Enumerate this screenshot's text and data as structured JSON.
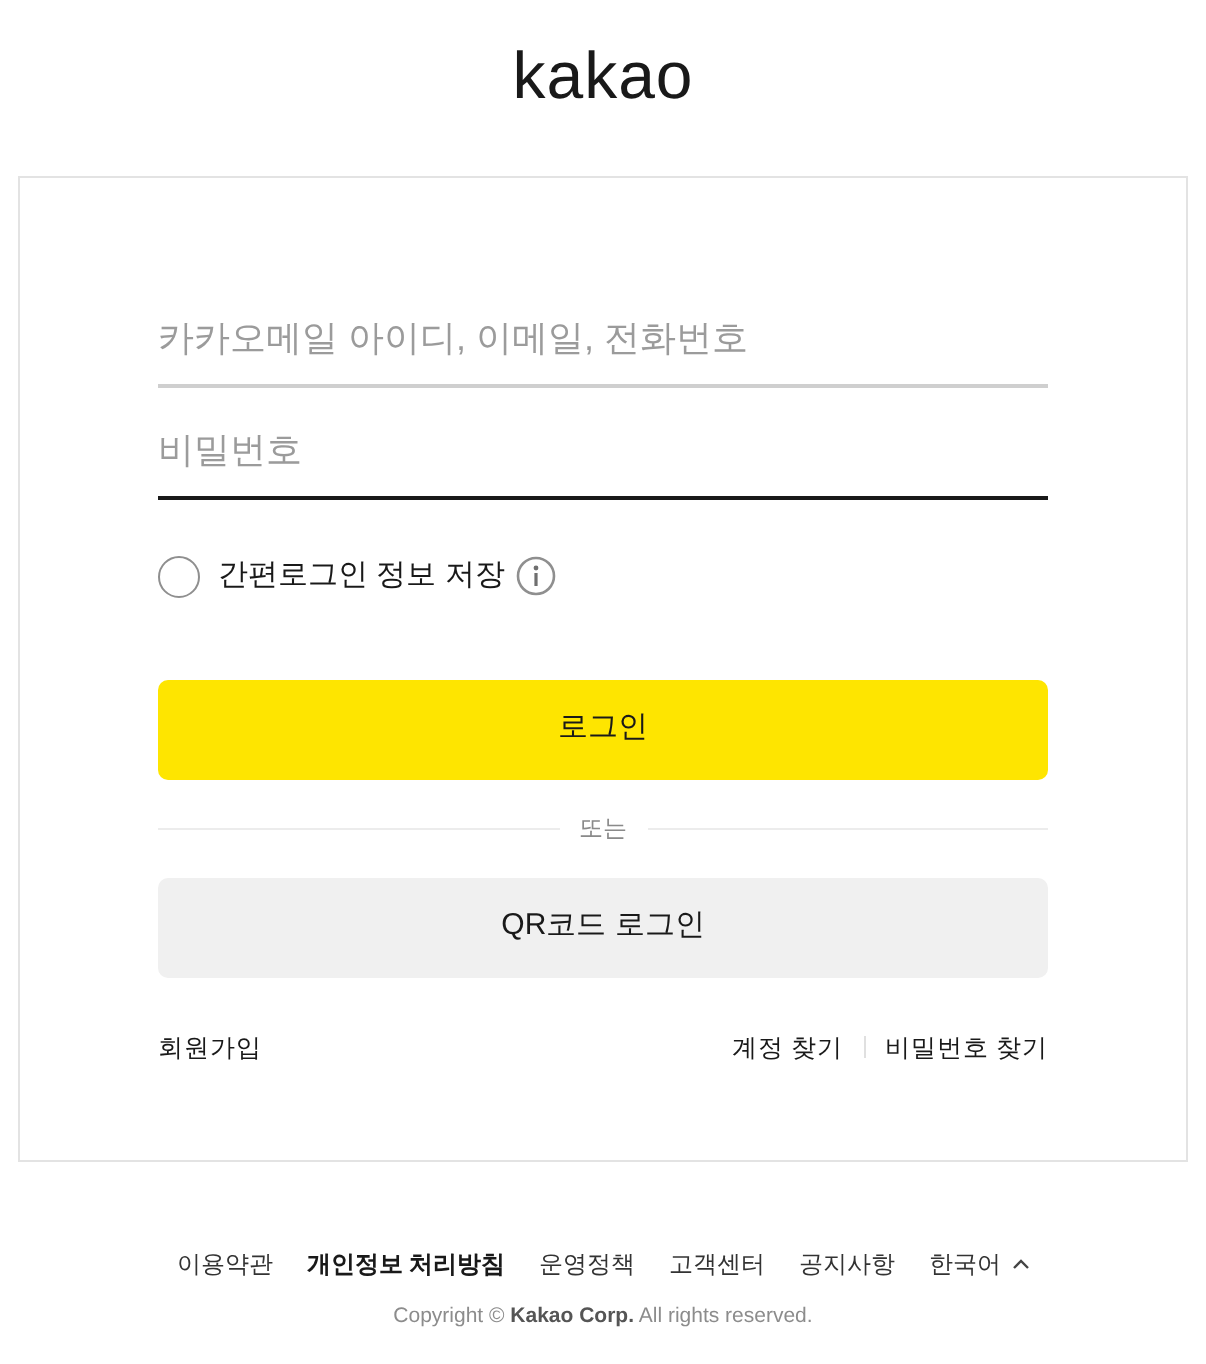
{
  "logo": {
    "text": "kakao"
  },
  "login_form": {
    "fields": [
      {
        "placeholder": "카카오메일 아이디, 이메일, 전화번호",
        "focused": false
      },
      {
        "placeholder": "비밀번호",
        "focused": true
      }
    ],
    "remember": {
      "label": "간편로그인 정보 저장",
      "checked": false
    },
    "login_button": "로그인",
    "divider": "또는",
    "qr_button": "QR코드 로그인",
    "signup_link": "회원가입",
    "find_links": [
      "계정 찾기",
      "비밀번호 찾기"
    ]
  },
  "footer": {
    "links": [
      {
        "kind": "link",
        "label": "이용약관",
        "bold": false
      },
      {
        "kind": "link",
        "label": "개인정보 처리방침",
        "bold": true
      },
      {
        "kind": "link",
        "label": "운영정책",
        "bold": false
      },
      {
        "kind": "link",
        "label": "고객센터",
        "bold": false
      },
      {
        "kind": "link",
        "label": "공지사항",
        "bold": false
      },
      {
        "kind": "language",
        "label": "한국어",
        "bold": false
      }
    ],
    "copyright": "Copyright © **Kakao Corp.** All rights reserved."
  }
}
